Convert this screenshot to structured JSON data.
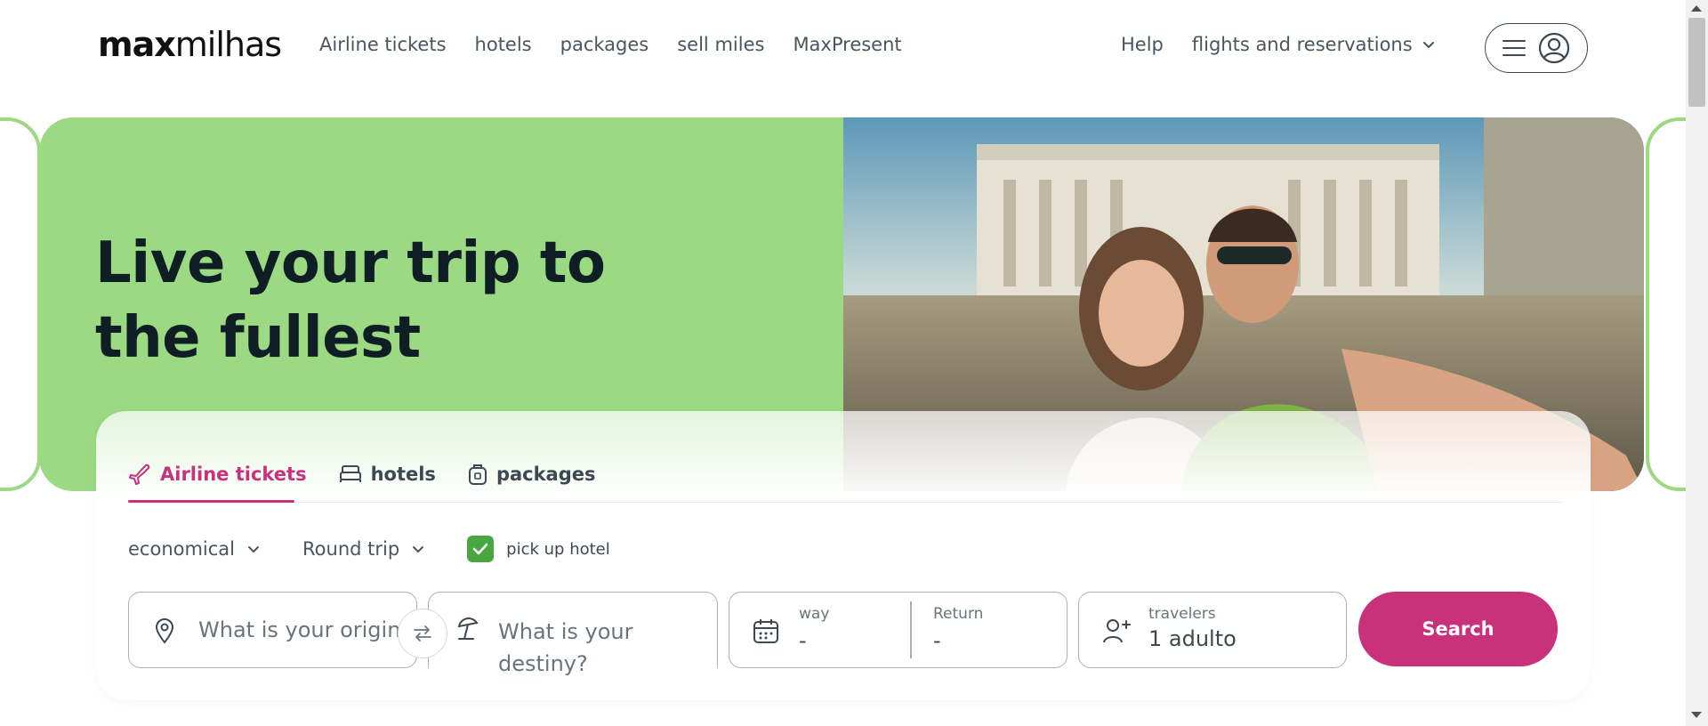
{
  "header": {
    "logo_bold": "max",
    "logo_light": "milhas",
    "nav": [
      "Airline tickets",
      "hotels",
      "packages",
      "sell miles",
      "MaxPresent"
    ],
    "help": "Help",
    "flights_reservations": "flights and reservations"
  },
  "hero": {
    "title": "Live your trip to the fullest"
  },
  "search": {
    "tabs": [
      {
        "label": "Airline tickets",
        "icon": "plane-icon",
        "active": true
      },
      {
        "label": "hotels",
        "icon": "bed-icon",
        "active": false
      },
      {
        "label": "packages",
        "icon": "suitcase-icon",
        "active": false
      }
    ],
    "cabin_class": "economical",
    "trip_type": "Round trip",
    "pick_up_hotel": "pick up hotel",
    "pick_up_hotel_checked": true,
    "origin_placeholder": "What is your origin?",
    "destination_placeholder": "What is your destiny?",
    "way_label": "way",
    "way_value": "-",
    "return_label": "Return",
    "return_value": "-",
    "travelers_label": "travelers",
    "travelers_value": "1 adulto",
    "search_button": "Search"
  },
  "colors": {
    "accent": "#c9317c",
    "hero_green": "#9bd982",
    "checkbox_green": "#4aa641"
  }
}
